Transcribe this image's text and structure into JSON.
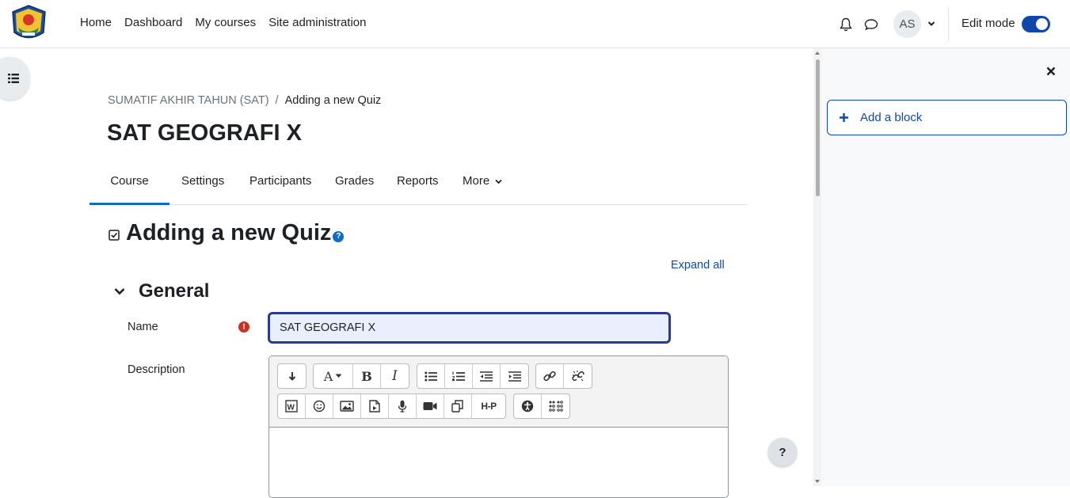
{
  "navbar": {
    "links": [
      "Home",
      "Dashboard",
      "My courses",
      "Site administration"
    ],
    "avatar_initials": "AS",
    "edit_mode_label": "Edit mode",
    "edit_mode_on": true
  },
  "breadcrumb": {
    "parent": "SUMATIF AKHIR TAHUN (SAT)",
    "separator": "/",
    "current": "Adding a new Quiz"
  },
  "page_title": "SAT GEOGRAFI X",
  "tabs": [
    "Course",
    "Settings",
    "Participants",
    "Grades",
    "Reports",
    "More"
  ],
  "active_tab": "Course",
  "form": {
    "heading": "Adding a new Quiz",
    "help_glyph": "?",
    "expand_all": "Expand all",
    "section_general": "General",
    "name_label": "Name",
    "name_value": "SAT GEOGRAFI X",
    "required_glyph": "!",
    "description_label": "Description"
  },
  "editor": {
    "row1_groups": [
      [
        "collapse-icon"
      ],
      [
        "font-icon",
        "bold-icon",
        "italic-icon"
      ],
      [
        "bullet-list-icon",
        "numbered-list-icon",
        "outdent-icon",
        "indent-icon"
      ],
      [
        "link-icon",
        "unlink-icon"
      ]
    ],
    "row2_groups": [
      [
        "word-import-icon",
        "emoji-icon",
        "image-icon",
        "document-icon",
        "audio-icon",
        "video-icon",
        "copy-icon",
        "h5p-icon"
      ],
      [
        "accessibility-icon",
        "braille-icon"
      ]
    ],
    "h5p_label": "H-P"
  },
  "help_button": "?",
  "block_drawer": {
    "add_block_label": "Add a block"
  },
  "colors": {
    "brand": "#0f47ad",
    "required": "#ca3120",
    "input_bg": "#e8f0fe"
  }
}
